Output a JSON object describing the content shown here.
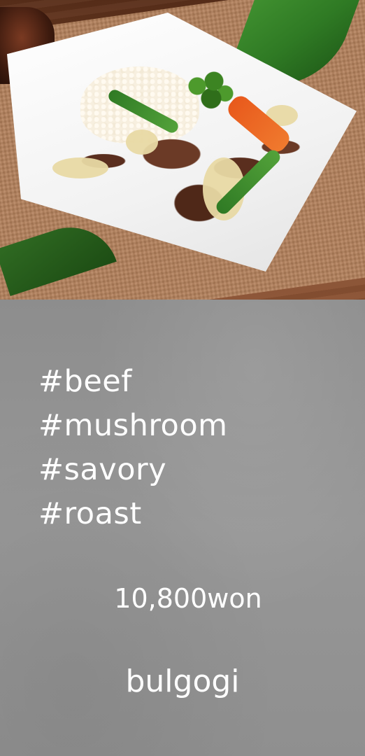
{
  "photo": {
    "subject": "bulgogi-dish-photo"
  },
  "tags": [
    "#beef",
    "#mushroom",
    "#savory",
    "#roast"
  ],
  "price": "10,800won",
  "name": "bulgogi",
  "colors": {
    "background": "#8f8f8f",
    "text": "#ffffff"
  }
}
